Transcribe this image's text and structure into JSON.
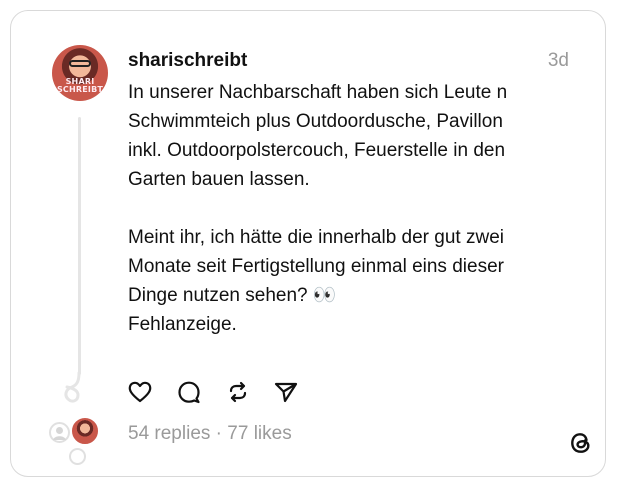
{
  "post": {
    "username": "sharischreibt",
    "time": "3d",
    "avatar_tag_line1": "SHARI",
    "avatar_tag_line2": "SCHREIBT",
    "lines": [
      "In unserer Nachbarschaft haben sich Leute n",
      "Schwimmteich plus Outdoordusche, Pavillon",
      "inkl. Outdoorpolstercouch, Feuerstelle in den",
      "Garten bauen lassen.",
      "",
      "Meint ihr, ich hätte die innerhalb der gut zwei",
      "Monate seit Fertigstellung einmal eins dieser",
      "Dinge nutzen sehen? 👀",
      "Fehlanzeige."
    ]
  },
  "actions": {
    "like_icon": "heart-icon",
    "reply_icon": "comment-icon",
    "repost_icon": "repost-icon",
    "share_icon": "send-icon"
  },
  "footer": {
    "replies": "54 replies",
    "separator": "·",
    "likes": "77 likes",
    "logo_icon": "threads-logo-icon"
  },
  "colors": {
    "text": "#111111",
    "muted": "#9a9a9a",
    "border": "#d9d9d9",
    "thread_line": "#e5e5e5"
  }
}
